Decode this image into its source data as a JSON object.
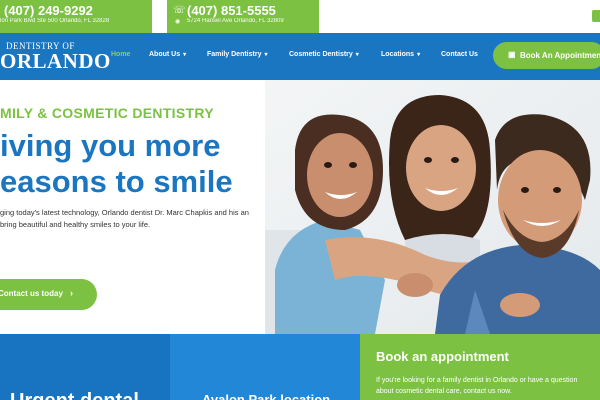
{
  "topbar": {
    "phone1": {
      "number": "(407) 249-9292",
      "address": "lon Park Blvd Ste 500 Orlando, FL 32828"
    },
    "phone2": {
      "number": "(407) 851-5555",
      "address": "5724 Hansel Ave Orlando, FL 32809"
    }
  },
  "logo": {
    "top": "DENTISTRY OF",
    "main": "ORLANDO"
  },
  "nav": {
    "home": "Home",
    "about": "About Us",
    "family": "Family Dentistry",
    "cosmetic": "Cosmetic Dentistry",
    "locations": "Locations",
    "contact": "Contact Us",
    "book": "Book An Appointment"
  },
  "hero": {
    "eyebrow": "MILY & COSMETIC DENTISTRY",
    "headline_line1": "iving you more",
    "headline_line2": "easons to smile",
    "lead": "ging today's latest technology, Orlando dentist Dr. Marc Chapkis and his an bring beautiful and healthy smiles to your life.",
    "cta": "Contact us today"
  },
  "cards": {
    "urgent": "Urgent dental",
    "avalon": "Avalon Park location",
    "book_title": "Book an appointment",
    "book_text": "If you're looking for a family dentist in Orlando or have a question about cosmetic dental care, contact us now."
  },
  "colors": {
    "brand_blue": "#1b76c2",
    "brand_green": "#7dc143",
    "nav_active": "#8fd14f"
  },
  "icons": [
    "phone-icon",
    "location-pin-icon",
    "calendar-icon",
    "chevron-right-icon",
    "chevron-down-icon"
  ]
}
